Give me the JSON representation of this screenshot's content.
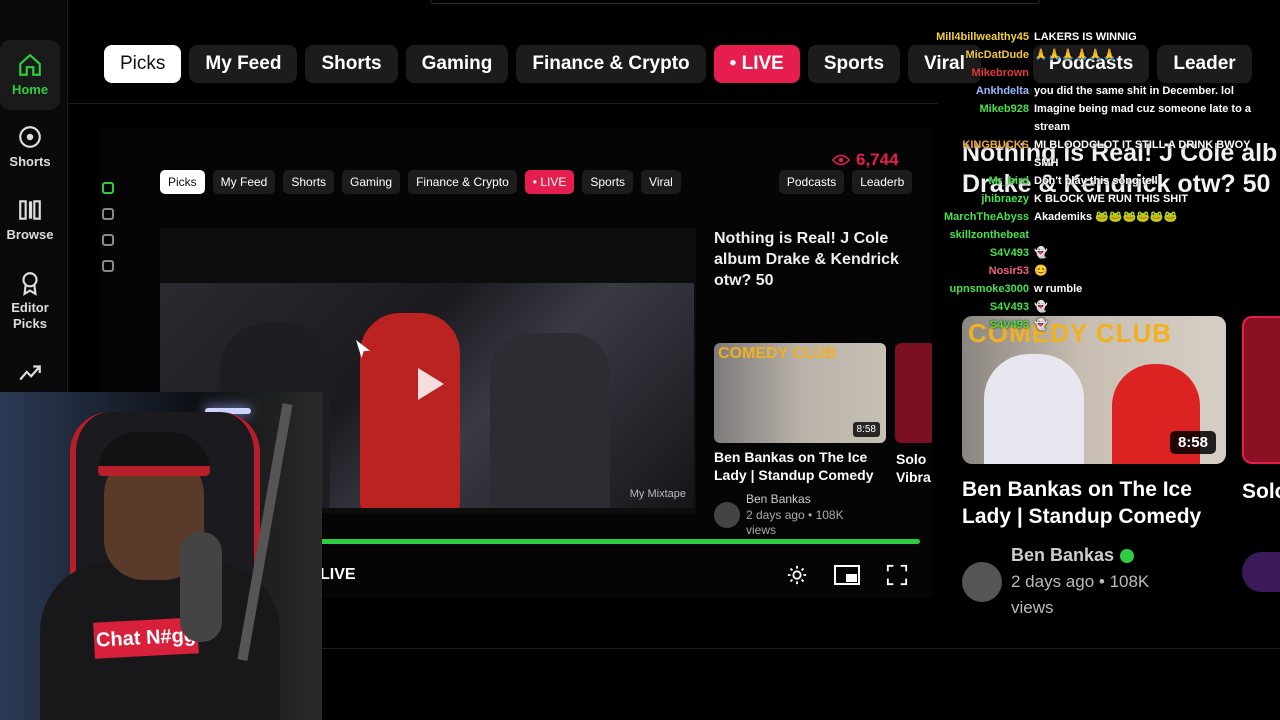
{
  "sidebar": {
    "items": [
      {
        "label": "Home",
        "icon": "home-icon",
        "active": true
      },
      {
        "label": "Shorts",
        "icon": "shorts-icon"
      },
      {
        "label": "Browse",
        "icon": "browse-icon"
      },
      {
        "label": "Editor Picks",
        "icon": "editor-picks-icon"
      },
      {
        "label": "",
        "icon": "trending-icon"
      }
    ]
  },
  "tabs": [
    "Picks",
    "My Feed",
    "Shorts",
    "Gaming",
    "Finance & Crypto",
    "• LIVE",
    "Sports",
    "Viral",
    "Podcasts",
    "Leader"
  ],
  "nested": {
    "viewers": "6,744",
    "tabs": [
      "Picks",
      "My Feed",
      "Shorts",
      "Gaming",
      "Finance & Crypto",
      "• LIVE",
      "Sports",
      "Viral",
      "Podcasts",
      "Leaderb"
    ],
    "live_label": "LIVE",
    "watermark": "My Mixtape",
    "title": "Nothing is Real! J Cole album Drake & Kendrick otw? 50",
    "video_title": "Ben Bankas on The Ice Lady | Standup Comedy",
    "video_title2": "Solo Vibra",
    "brand": "COMEDY CLUB",
    "duration": "8:58",
    "author": "Ben Bankas",
    "meta": "2 days ago • 108K views"
  },
  "right": {
    "title_line1": "Nothing is Real! J Cole alb",
    "title_line2": "Drake & Kendrick otw? 50",
    "brand": "COMEDY CLUB",
    "duration": "8:58",
    "video_title": "Ben Bankas on The Ice Lady | Standup Comedy",
    "video_title2": "Solo Vibr",
    "author": "Ben Bankas",
    "meta": "2 days ago • 108K views"
  },
  "chat": [
    {
      "user": "Mill4billwealthy45",
      "text": "LAKERS IS WINNIG",
      "color": "#f2d03a"
    },
    {
      "user": "MicDatDude",
      "text": "🙏🙏🙏🙏🙏🙏",
      "color": "#f2c542"
    },
    {
      "user": "Mikebrown",
      "text": "",
      "color": "#e23b3b"
    },
    {
      "user": "Ankhdelta",
      "text": "you did the same shit in December. lol",
      "color": "#9ab8ff"
    },
    {
      "user": "Mikeb928",
      "text": "Imagine being mad cuz someone late to a",
      "color": "#49e04e"
    },
    {
      "user": "",
      "text": "stream",
      "color": "#ffffff"
    },
    {
      "user": "KINGBUCKS",
      "text": "MI BLOODCLOT IT STILL A DRINK BWOY",
      "color": "#f2a93a"
    },
    {
      "user": "",
      "text": "SMH",
      "color": "#ffffff"
    },
    {
      "user": "Mr_bird",
      "text": "Don't play this song tell",
      "color": "#49e04e"
    },
    {
      "user": "jhibraezy",
      "text": "K BLOCK WE RUN THIS SHIT",
      "color": "#49e04e"
    },
    {
      "user": "MarchTheAbyss",
      "text": "Akademiks 🐸🐸🐸🐸🐸🐸",
      "color": "#49e04e"
    },
    {
      "user": "skillzonthebeat",
      "text": "",
      "color": "#49e04e"
    },
    {
      "user": "S4V493",
      "text": "👻",
      "color": "#49e04e"
    },
    {
      "user": "Nosir53",
      "text": "😊",
      "color": "#f06080"
    },
    {
      "user": "upnsmoke3000",
      "text": "w rumble",
      "color": "#49e04e"
    },
    {
      "user": "S4V493",
      "text": "👻",
      "color": "#49e04e"
    },
    {
      "user": "S4V493",
      "text": "👻",
      "color": "#49e04e"
    }
  ],
  "webcam": {
    "shirt_text": "Chat N#gg"
  },
  "colors": {
    "accent": "#2ecc40",
    "live": "#e51e4f"
  }
}
